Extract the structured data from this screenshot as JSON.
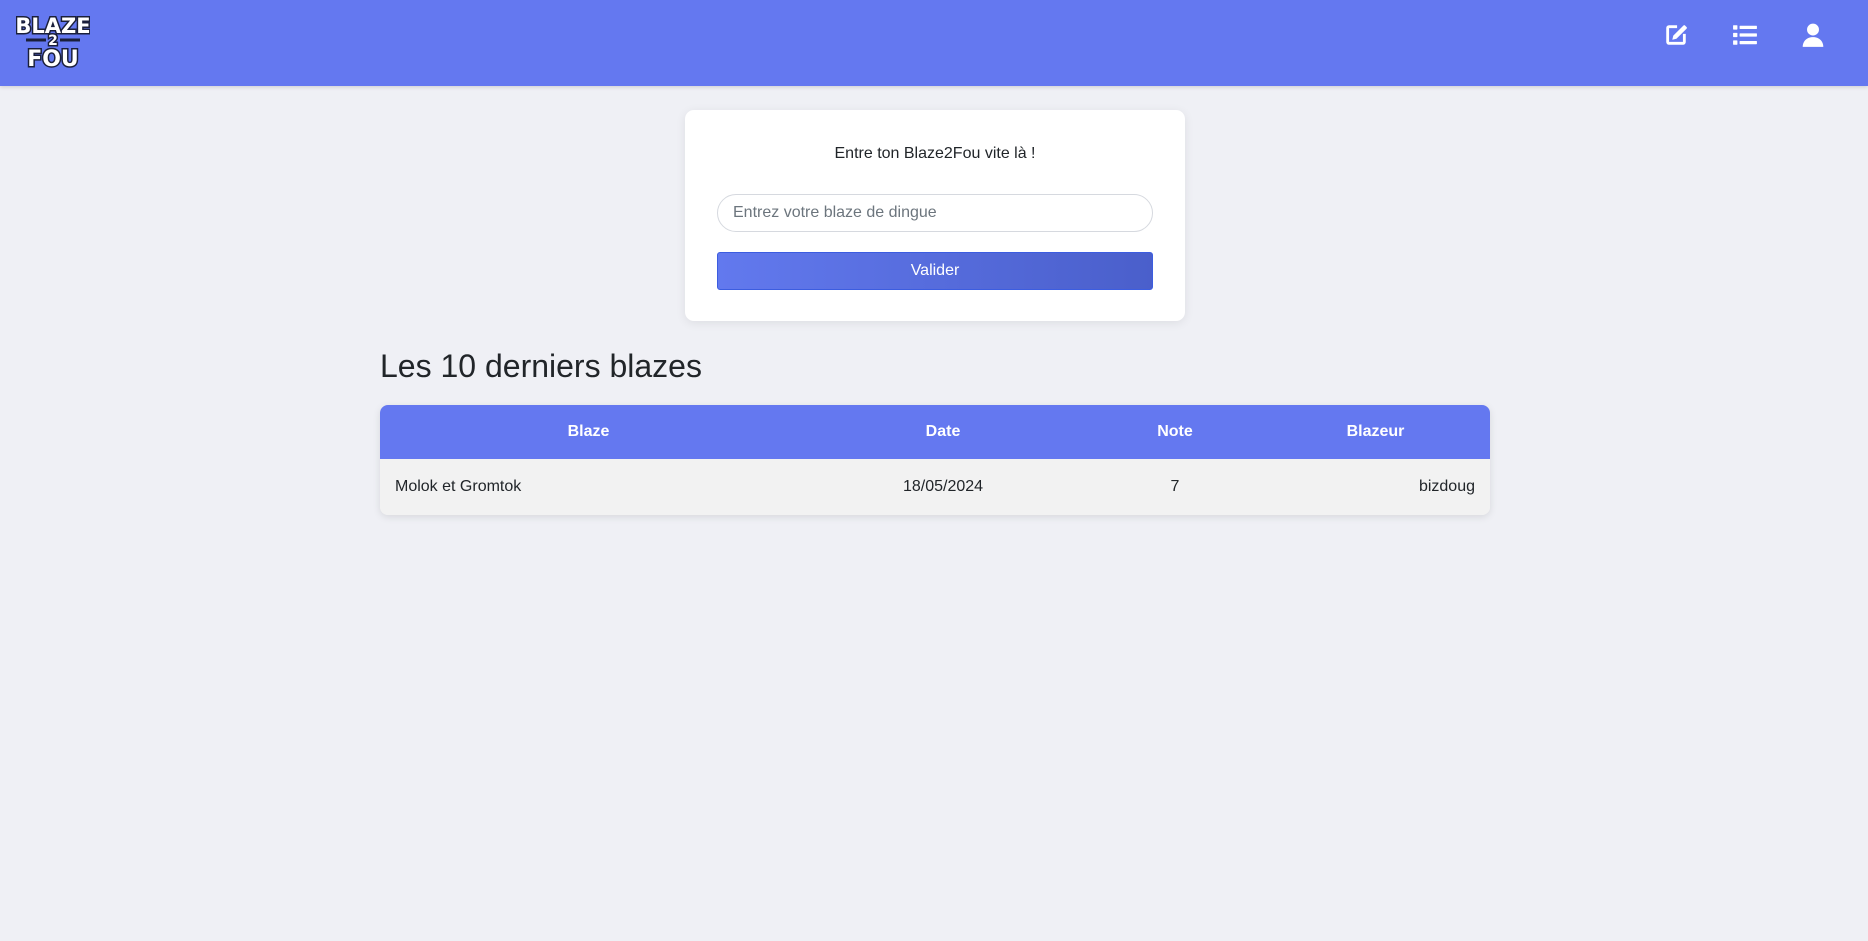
{
  "navbar": {
    "logo": {
      "line1": "BLAZE",
      "line2": "2",
      "line3": "FOU"
    },
    "icons": [
      "edit-icon",
      "list-icon",
      "user-icon"
    ],
    "background_color": "#6478f0"
  },
  "form": {
    "title": "Entre ton Blaze2Fou vite là !",
    "input_placeholder": "Entrez votre blaze de dingue",
    "input_value": "",
    "submit_label": "Valider"
  },
  "recent": {
    "title": "Les 10 derniers blazes",
    "columns": [
      "Blaze",
      "Date",
      "Note",
      "Blazeur"
    ],
    "rows": [
      {
        "blaze": "Molok et Gromtok",
        "date": "18/05/2024",
        "note": "7",
        "blazeur": "bizdoug"
      }
    ]
  }
}
